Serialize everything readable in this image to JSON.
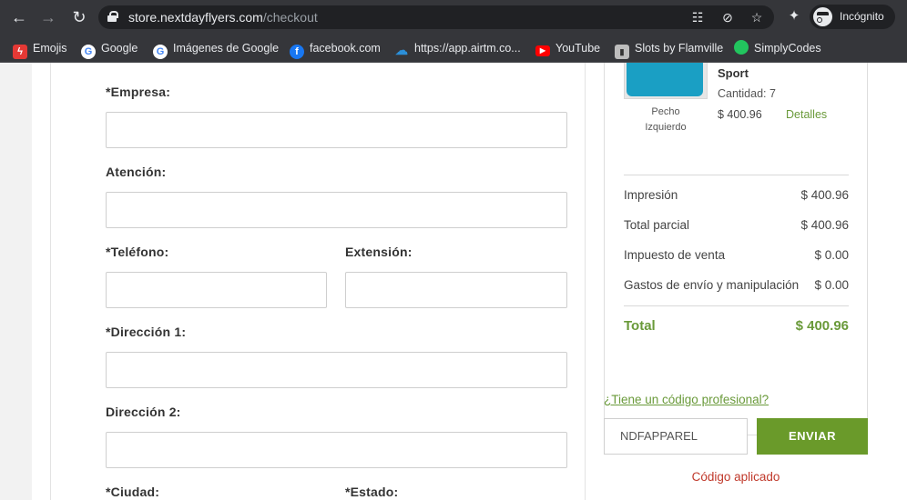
{
  "browser": {
    "url_host": "store.nextdayflyers.com",
    "url_path": "/checkout",
    "incognito_label": "Incógnito"
  },
  "bookmarks": [
    {
      "label": "Emojis",
      "icon": "lightning-icon",
      "color": "#e53935"
    },
    {
      "label": "Google",
      "icon": "google-icon",
      "color": "#ffffff"
    },
    {
      "label": "Imágenes de Google",
      "icon": "google-icon",
      "color": "#ffffff"
    },
    {
      "label": "facebook.com",
      "icon": "facebook-icon",
      "color": "#1877f2"
    },
    {
      "label": "https://app.airtm.co...",
      "icon": "airtm-icon",
      "color": "#2b8fd8"
    },
    {
      "label": "YouTube",
      "icon": "youtube-icon",
      "color": "#ff0000"
    },
    {
      "label": "Slots by Flamville",
      "icon": "slots-icon",
      "color": "#bdbdbd"
    },
    {
      "label": "SimplyCodes",
      "icon": "simplycodes-icon",
      "color": "#22c55e"
    }
  ],
  "form": {
    "company_label": "*Empresa:",
    "attention_label": "Atención:",
    "phone_label": "*Teléfono:",
    "extension_label": "Extensión:",
    "address1_label": "*Dirección 1:",
    "address2_label": "Dirección 2:",
    "city_label": "*Ciudad:",
    "state_label": "*Estado:"
  },
  "product": {
    "name": "Sport",
    "quantity": "Cantidad: 7",
    "price": "$ 400.96",
    "details_link": "Detalles",
    "caption_line1": "Pecho",
    "caption_line2": "Izquierdo"
  },
  "summary": {
    "rows": [
      {
        "label": "Impresión",
        "value": "$ 400.96"
      },
      {
        "label": "Total parcial",
        "value": "$ 400.96"
      },
      {
        "label": "Impuesto de venta",
        "value": "$ 0.00"
      },
      {
        "label": "Gastos de envío y manipulación",
        "value": "$ 0.00"
      }
    ],
    "total_label": "Total",
    "total_value": "$ 400.96"
  },
  "promo": {
    "link": "¿Tiene un código profesional?",
    "code_value": "NDFAPPAREL",
    "submit_label": "ENVIAR",
    "message": "Código aplicado"
  },
  "colors": {
    "accent": "#6a9a2a",
    "error": "#c0392b"
  }
}
